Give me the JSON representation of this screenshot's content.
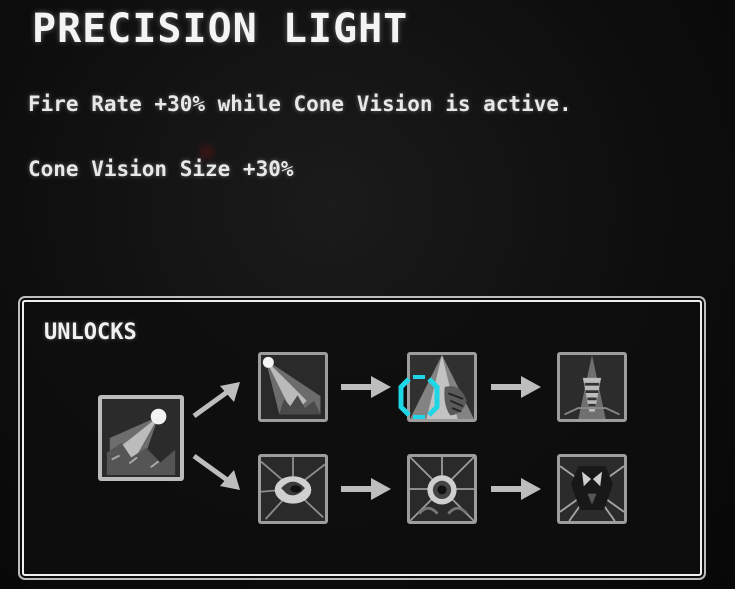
{
  "title": "PRECISION LIGHT",
  "description": [
    "Fire Rate +30% while Cone Vision is active.",
    "Cone Vision Size +30%"
  ],
  "unlocks": {
    "label": "UNLOCKS",
    "root_icon": "flashlight-beam-icon",
    "branches": [
      {
        "icons": [
          "light-beam-ruins-icon",
          "light-cone-creature-icon",
          "drill-beam-icon"
        ],
        "selected": 1
      },
      {
        "icons": [
          "swirl-orb-icon",
          "eye-burst-icon",
          "creature-face-burst-icon"
        ],
        "selected": null
      }
    ],
    "selection_color": "#1fd6e6"
  }
}
